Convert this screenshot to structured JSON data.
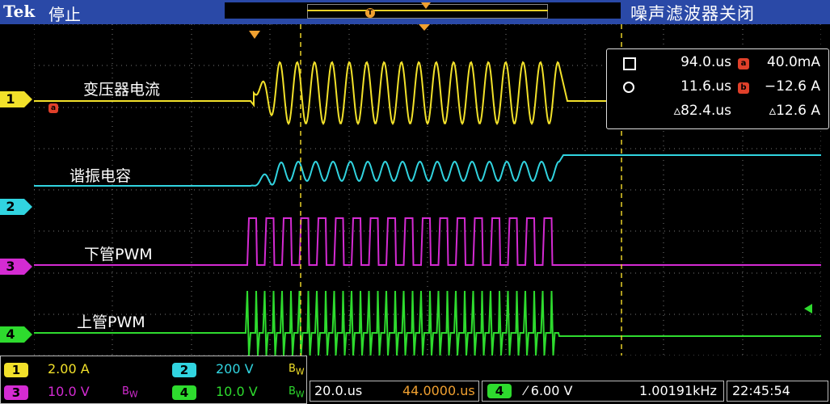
{
  "header": {
    "brand": "Tek",
    "run_state": "停止",
    "status_right": "噪声滤波器关闭"
  },
  "record": {
    "trigger_marker": "T"
  },
  "channel_markers": [
    {
      "id": "1",
      "color": "#f2e12a"
    },
    {
      "id": "2",
      "color": "#31d4e0"
    },
    {
      "id": "3",
      "color": "#d42bd2"
    },
    {
      "id": "4",
      "color": "#2edb2e"
    }
  ],
  "waveform_labels": {
    "ch1": "变压器电流",
    "ch2": "谐振电容",
    "ch3": "下管PWM",
    "ch4": "上管PWM"
  },
  "math_marker": "a",
  "measurements": {
    "row1": {
      "time": "94.0.us",
      "value": "40.0mA"
    },
    "row2": {
      "time": "11.6.us",
      "value": "−12.6 A"
    },
    "row3": {
      "time": "▵82.4.us",
      "value": "▵12.6 A"
    },
    "row1_tag": "a",
    "row2_tag": "b"
  },
  "bottom": {
    "ch1_scale": "2.00 A",
    "ch2_scale": "200 V",
    "ch3_scale": "10.0 V",
    "ch4_scale": "10.0 V",
    "bw_label": "B",
    "bw_sub": "W",
    "timebase": "20.0.us",
    "position": "44.0000.us",
    "trigger_channel": "4",
    "trigger_level": "⁄ 6.00 V",
    "frequency": "1.00191kHz",
    "clock": "22:45:54"
  },
  "colors": {
    "ch1": "#f2e12a",
    "ch2": "#31d4e0",
    "ch3": "#d42bd2",
    "ch4": "#2edb2e",
    "header_bg": "#2a49a7",
    "trigger": "#f0a030"
  }
}
